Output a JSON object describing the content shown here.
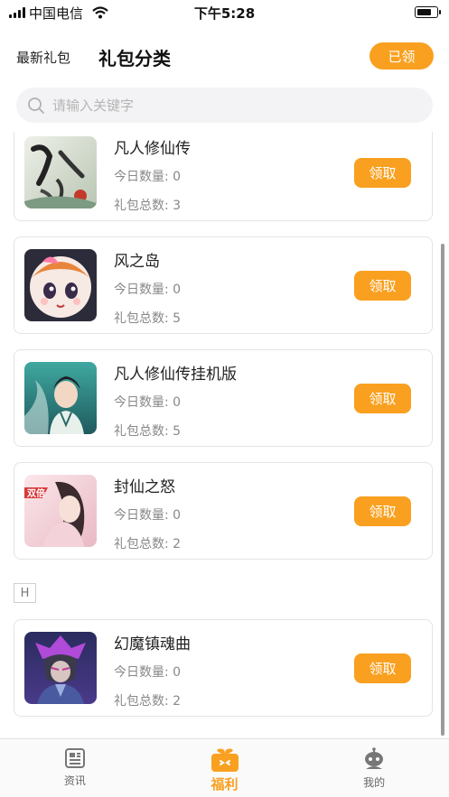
{
  "status_bar": {
    "carrier": "中国电信",
    "time": "下午5:28"
  },
  "header": {
    "tab_latest": "最新礼包",
    "tab_category": "礼包分类",
    "claimed_button": "已领"
  },
  "search": {
    "placeholder": "请输入关键字",
    "value": ""
  },
  "games": [
    {
      "name": "凡人修仙传",
      "today_label": "今日数量:",
      "today_count": "0",
      "total_label": "礼包总数:",
      "total_count": "3",
      "claim_label": "领取",
      "icon": "fanren-xiuxian-icon"
    },
    {
      "name": "风之岛",
      "today_label": "今日数量:",
      "today_count": "0",
      "total_label": "礼包总数:",
      "total_count": "5",
      "claim_label": "领取",
      "icon": "fengzhidao-icon"
    },
    {
      "name": "凡人修仙传挂机版",
      "today_label": "今日数量:",
      "today_count": "0",
      "total_label": "礼包总数:",
      "total_count": "5",
      "claim_label": "领取",
      "icon": "fanren-guaji-icon"
    },
    {
      "name": "封仙之怒",
      "today_label": "今日数量:",
      "today_count": "0",
      "total_label": "礼包总数:",
      "total_count": "2",
      "claim_label": "领取",
      "icon": "fengxian-icon"
    },
    {
      "name": "幻魔镇魂曲",
      "today_label": "今日数量:",
      "today_count": "0",
      "total_label": "礼包总数:",
      "total_count": "2",
      "claim_label": "领取",
      "icon": "huanmo-icon"
    }
  ],
  "section_letter": "H",
  "badge_text": "双倍",
  "tabbar": [
    {
      "label": "资讯",
      "icon": "news-icon"
    },
    {
      "label": "福利",
      "icon": "gift-icon"
    },
    {
      "label": "我的",
      "icon": "profile-icon"
    }
  ],
  "colors": {
    "accent": "#f9a020",
    "text": "#222222",
    "muted": "#888888",
    "card_border": "#e4e4e6"
  }
}
